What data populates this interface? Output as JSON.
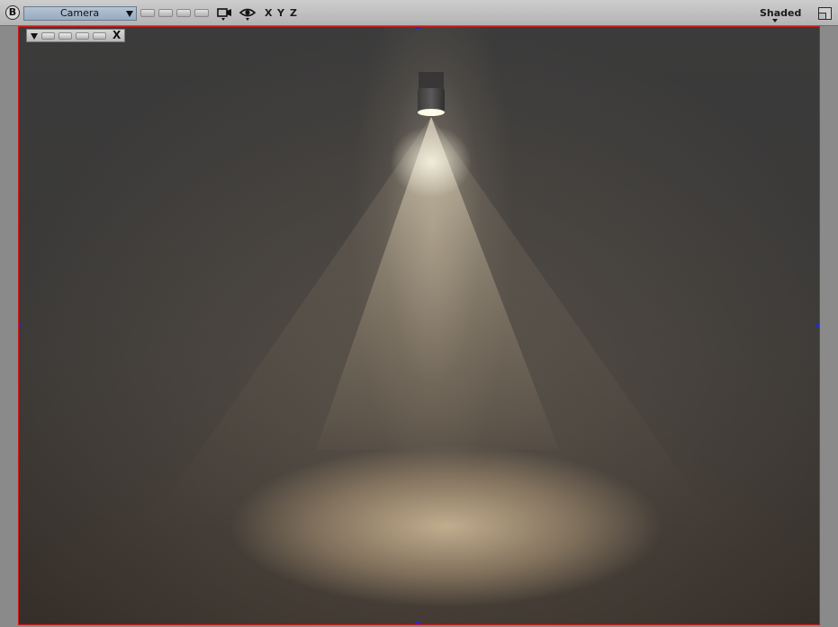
{
  "toolbar": {
    "brand_letter": "B",
    "camera_label": "Camera",
    "axes": [
      "X",
      "Y",
      "Z"
    ],
    "shading_mode": "Shaded",
    "icons": [
      "camera-move-icon",
      "eye-visibility-icon",
      "maximize-icon"
    ]
  },
  "mini_panel": {
    "close_label": "X"
  },
  "colors": {
    "toolbar_bg": "#c4c4c4",
    "camera_select_bg": "#a8bacb",
    "viewport_border": "#d01818",
    "handle": "#2030c0",
    "light_color": "#e6d9bf",
    "scene_bg": "#3a3836"
  }
}
